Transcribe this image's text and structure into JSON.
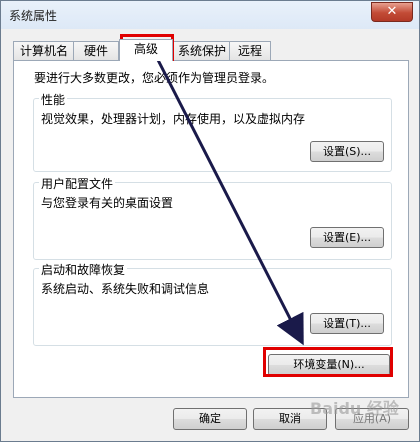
{
  "window": {
    "title": "系统属性",
    "close_glyph": "✕"
  },
  "tabs": [
    {
      "label": "计算机名"
    },
    {
      "label": "硬件"
    },
    {
      "label": "高级"
    },
    {
      "label": "系统保护"
    },
    {
      "label": "远程"
    }
  ],
  "panel": {
    "notice": "要进行大多数更改，您必须作为管理员登录。",
    "groups": [
      {
        "title": "性能",
        "desc": "视觉效果，处理器计划，内存使用，以及虚拟内存",
        "button": "设置(S)..."
      },
      {
        "title": "用户配置文件",
        "desc": "与您登录有关的桌面设置",
        "button": "设置(E)..."
      },
      {
        "title": "启动和故障恢复",
        "desc": "系统启动、系统失败和调试信息",
        "button": "设置(T)..."
      }
    ],
    "env_button": "环境变量(N)..."
  },
  "footer": {
    "ok": "确定",
    "cancel": "取消",
    "apply": "应用(A)"
  },
  "watermark": "Baidu 经验",
  "colors": {
    "highlight": "#e00000",
    "arrow": "#1a1a4a"
  }
}
